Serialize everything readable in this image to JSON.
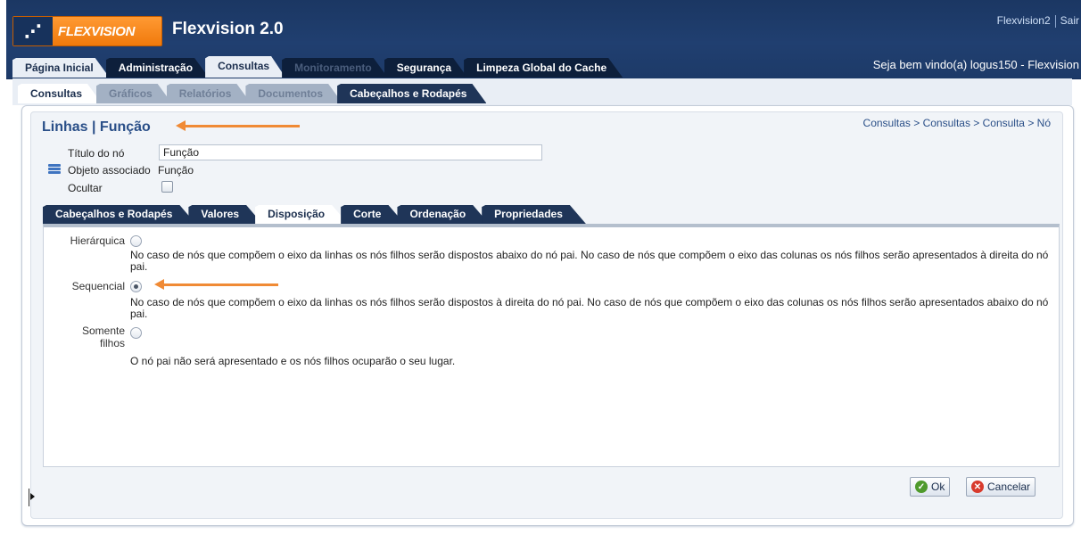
{
  "header": {
    "logo_text": "FLEXVISION",
    "app_title": "Flexvision 2.0",
    "user_link": "Flexvision2",
    "logout_link": "Sair",
    "welcome": "Seja bem vindo(a) logus150 - Flexvision"
  },
  "main_tabs": [
    {
      "label": "Página Inicial",
      "state": "normal"
    },
    {
      "label": "Administração",
      "state": "normal"
    },
    {
      "label": "Consultas",
      "state": "active"
    },
    {
      "label": "Monitoramento",
      "state": "disabled"
    },
    {
      "label": "Segurança",
      "state": "normal"
    },
    {
      "label": "Limpeza Global do Cache",
      "state": "normal"
    }
  ],
  "sub_tabs": [
    {
      "label": "Consultas",
      "state": "active"
    },
    {
      "label": "Gráficos",
      "state": "normal"
    },
    {
      "label": "Relatórios",
      "state": "normal"
    },
    {
      "label": "Documentos",
      "state": "normal"
    },
    {
      "label": "Cabeçalhos e Rodapés",
      "state": "dark"
    }
  ],
  "page": {
    "title": "Linhas | Função",
    "breadcrumb": "Consultas > Consultas > Consulta > Nó"
  },
  "form": {
    "node_title_label": "Título do nó",
    "node_title_value": "Função",
    "associated_object_label": "Objeto associado",
    "associated_object_value": "Função",
    "hide_label": "Ocultar",
    "hide_checked": false
  },
  "inner_tabs": [
    {
      "label": "Cabeçalhos e Rodapés",
      "state": "normal"
    },
    {
      "label": "Valores",
      "state": "normal"
    },
    {
      "label": "Disposição",
      "state": "active"
    },
    {
      "label": "Corte",
      "state": "normal"
    },
    {
      "label": "Ordenação",
      "state": "normal"
    },
    {
      "label": "Propriedades",
      "state": "normal"
    }
  ],
  "layout_options": {
    "hierarchical": {
      "label": "Hierárquica",
      "checked": false,
      "description": "No caso de nós que compõem o eixo da linhas os nós filhos serão dispostos abaixo do nó pai. No caso de nós que compõem o eixo das colunas os nós filhos serão apresentados à direita do nó pai."
    },
    "sequential": {
      "label": "Sequencial",
      "checked": true,
      "description": "No caso de nós que compõem o eixo da linhas os nós filhos serão dispostos à direita do nó pai. No caso de nós que compõem o eixo das colunas os nós filhos serão apresentados abaixo do nó pai."
    },
    "children_only": {
      "label_line1": "Somente",
      "label_line2": "filhos",
      "checked": false,
      "description": "O nó pai não será apresentado e os nós filhos ocuparão o seu lugar."
    }
  },
  "buttons": {
    "ok": "Ok",
    "cancel": "Cancelar"
  },
  "colors": {
    "header": "#1f3c6b",
    "accent_orange": "#f08a35",
    "title_blue": "#2a4f88"
  }
}
